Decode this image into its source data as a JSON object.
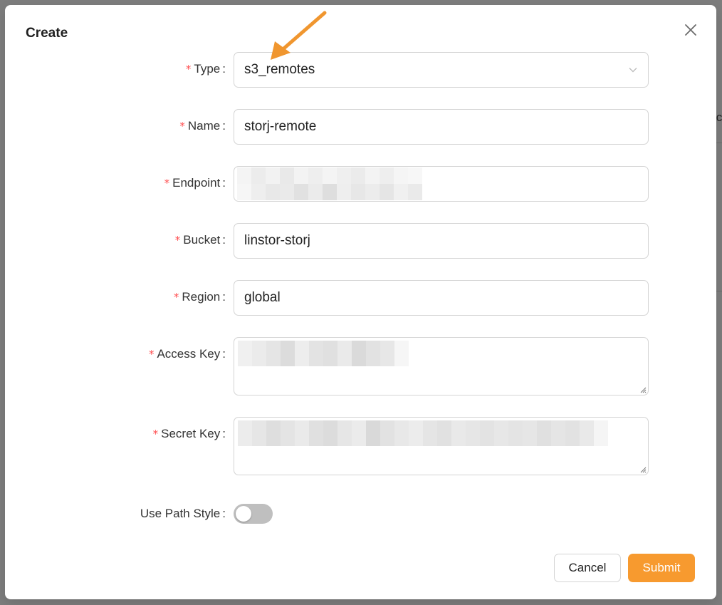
{
  "background_peek": "ic",
  "dialog": {
    "title": "Create",
    "fields": [
      {
        "key": "type",
        "label": "Type",
        "required": true,
        "kind": "select",
        "value": "s3_remotes"
      },
      {
        "key": "name",
        "label": "Name",
        "required": true,
        "kind": "input",
        "value": "storj-remote"
      },
      {
        "key": "endpoint",
        "label": "Endpoint",
        "required": true,
        "kind": "input",
        "value": "",
        "redacted": true
      },
      {
        "key": "bucket",
        "label": "Bucket",
        "required": true,
        "kind": "input",
        "value": "linstor-storj"
      },
      {
        "key": "region",
        "label": "Region",
        "required": true,
        "kind": "input",
        "value": "global"
      },
      {
        "key": "access_key",
        "label": "Access Key",
        "required": true,
        "kind": "textarea",
        "value": "",
        "redacted": true
      },
      {
        "key": "secret_key",
        "label": "Secret Key",
        "required": true,
        "kind": "textarea",
        "value": "",
        "redacted": true
      }
    ],
    "use_path_style": {
      "label": "Use Path Style",
      "checked": false
    },
    "cancel_label": "Cancel",
    "submit_label": "Submit",
    "required_mark": "*",
    "colon": ":"
  },
  "icons": {
    "close": "close-icon",
    "select_arrow": "chevron-down-icon",
    "resize": "resize-handle-icon",
    "annotation": "arrow-annotation-icon"
  },
  "colors": {
    "accent": "#f79a2f",
    "required": "#ff4d4f",
    "border": "#d4d4d4",
    "toggle_off": "#bfbfbf",
    "annotation_arrow": "#f0962f"
  }
}
